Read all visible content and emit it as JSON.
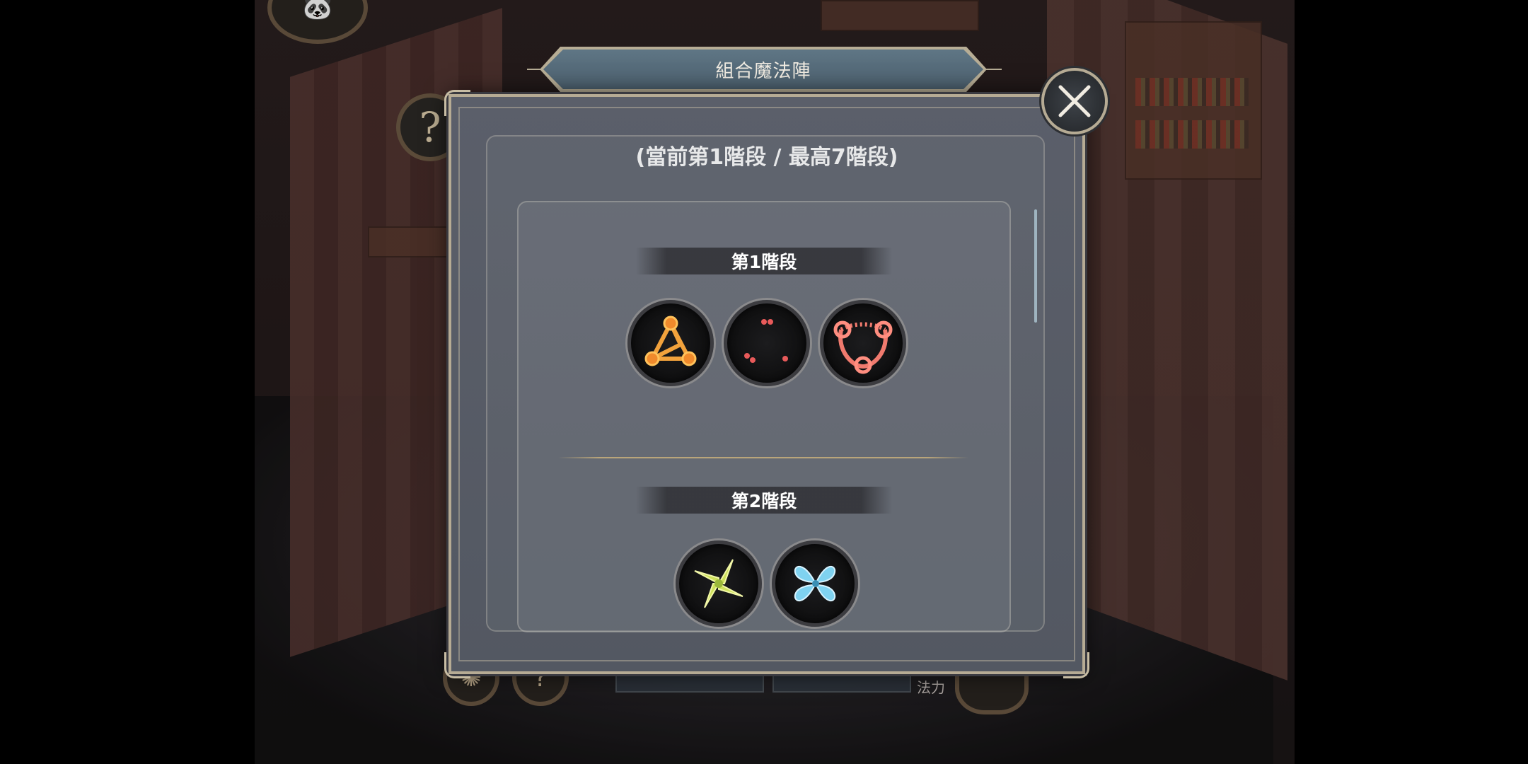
{
  "dialog": {
    "title": "組合魔法陣",
    "stage_info": "(當前第1階段 / 最高7階段)",
    "close_icon": "close-icon",
    "sections": [
      {
        "label": "第1階段",
        "runes": [
          {
            "icon": "triangle-rune-icon",
            "color": "#f0a23a"
          },
          {
            "icon": "dots-rune-icon",
            "color": "#e85a5a"
          },
          {
            "icon": "ring-rune-icon",
            "color": "#f07a6e"
          }
        ]
      },
      {
        "label": "第2階段",
        "runes": [
          {
            "icon": "leaf-star-rune-icon",
            "color": "#cde05a"
          },
          {
            "icon": "petal-rune-icon",
            "color": "#7fd2f0"
          }
        ]
      }
    ]
  },
  "background": {
    "help_icon": "?",
    "bottom_label": "法力"
  }
}
